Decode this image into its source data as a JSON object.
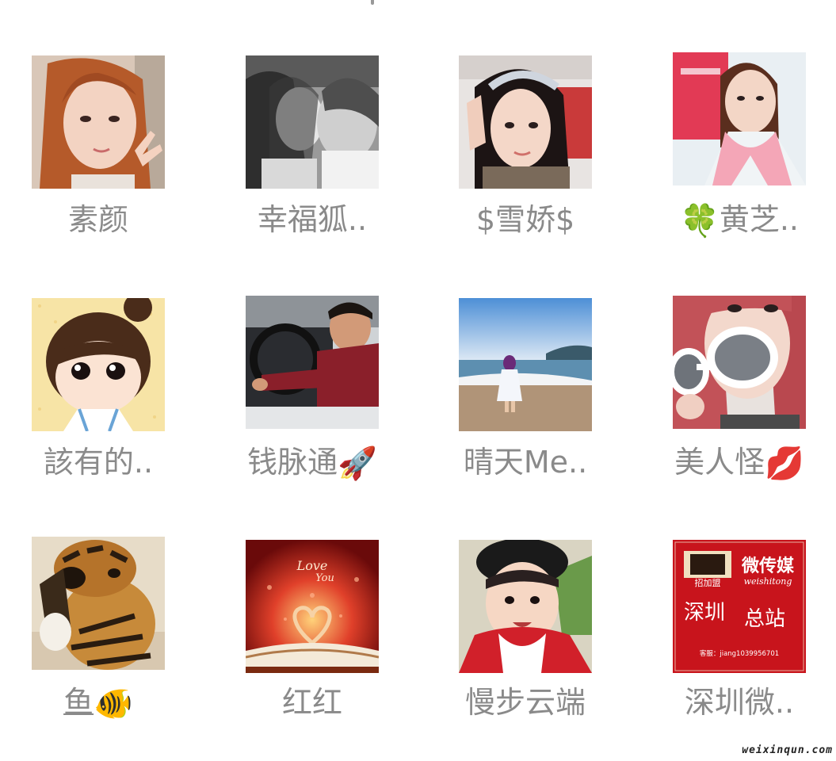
{
  "members": [
    {
      "name": "素颜",
      "emoji": "",
      "avatar": "avatar-woman-peace-sign"
    },
    {
      "name": "幸福狐..",
      "emoji": "",
      "avatar": "avatar-kissing-kids-bw"
    },
    {
      "name": "$雪娇$",
      "emoji": "",
      "avatar": "avatar-woman-sunglasses-head"
    },
    {
      "name": "黄芝..",
      "emoji": "🍀",
      "avatar": "avatar-woman-pink-scarf"
    },
    {
      "name": "該有的..",
      "emoji": "",
      "avatar": "avatar-cartoon-girl"
    },
    {
      "name": "钱脉通",
      "emoji": "🚀",
      "avatar": "avatar-boy-driving"
    },
    {
      "name": "晴天Me..",
      "emoji": "",
      "avatar": "avatar-girl-beach"
    },
    {
      "name": "美人怪",
      "emoji": "💋",
      "avatar": "avatar-woman-white-sunglasses"
    },
    {
      "name": "鱼",
      "emoji": "🐠",
      "avatar": "avatar-tiger-puppy"
    },
    {
      "name": "红红",
      "emoji": "",
      "avatar": "avatar-love-book-heart"
    },
    {
      "name": "慢步云端",
      "emoji": "",
      "avatar": "avatar-toddler-red"
    },
    {
      "name": "深圳微..",
      "emoji": "",
      "avatar": "avatar-weishitong-ad"
    }
  ],
  "ad_card": {
    "brand": "微传媒",
    "brand_sub": "weishitong",
    "badge": "招加盟",
    "city": "深圳",
    "station": "总站",
    "service": "客服：jiang1039956701"
  },
  "love_card": {
    "text1": "Love",
    "text2": "You"
  },
  "watermark": "weixinqun.com"
}
